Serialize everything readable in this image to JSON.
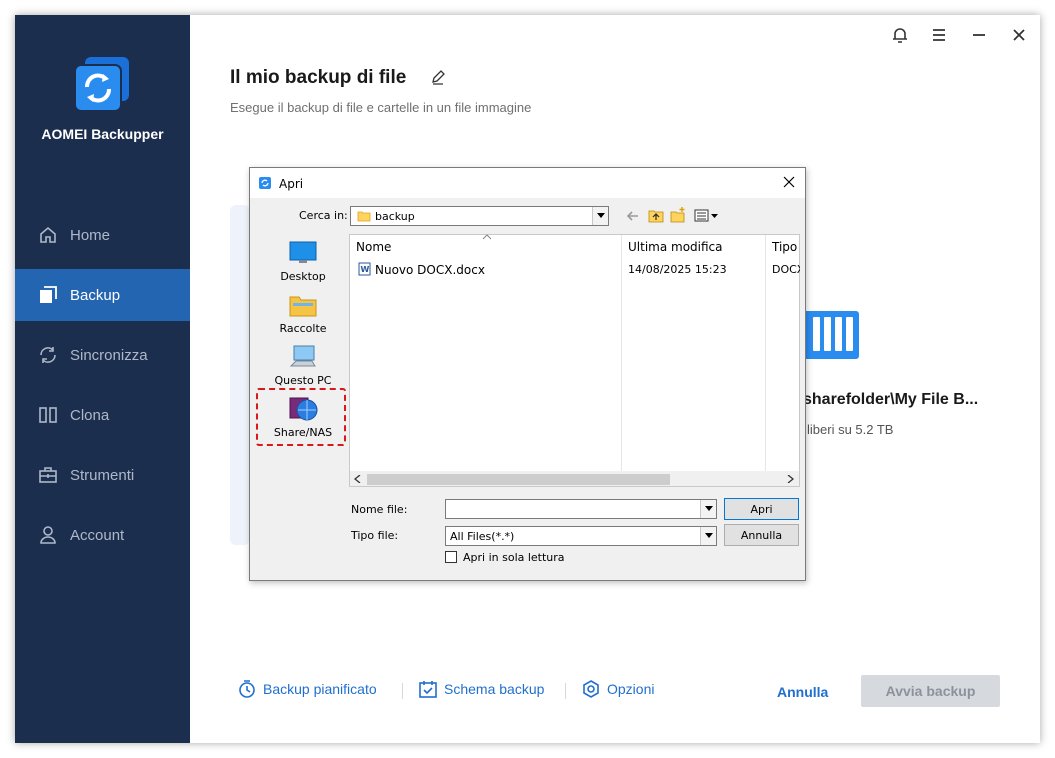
{
  "app": {
    "name": "AOMEI Backupper",
    "accent": "#2365b0",
    "sidebar_bg": "#1c2e4d"
  },
  "sidebar": {
    "items": [
      {
        "label": "Home",
        "icon": "home-icon"
      },
      {
        "label": "Backup",
        "icon": "backup-icon",
        "active": true
      },
      {
        "label": "Sincronizza",
        "icon": "sync-icon"
      },
      {
        "label": "Clona",
        "icon": "clone-icon"
      },
      {
        "label": "Strumenti",
        "icon": "tools-icon"
      },
      {
        "label": "Account",
        "icon": "account-icon"
      }
    ]
  },
  "window_controls": [
    "bell-icon",
    "menu-icon",
    "minimize-icon",
    "close-icon"
  ],
  "main": {
    "title": "Il mio backup di file",
    "subtitle": "Esegue il backup di file e cartelle in un file immagine",
    "destination": {
      "path": "sharefolder\\My File B...",
      "free": "liberi su 5.2 TB"
    },
    "bottom": {
      "scheduled": "Backup pianificato",
      "scheme": "Schema backup",
      "options": "Opzioni",
      "cancel": "Annulla",
      "start": "Avvia backup"
    }
  },
  "dialog": {
    "title": "Apri",
    "look_in_label": "Cerca in:",
    "look_in_value": "backup",
    "places": [
      "Desktop",
      "Raccolte",
      "Questo PC",
      "Share/NAS"
    ],
    "columns": [
      "Nome",
      "Ultima modifica",
      "Tipo"
    ],
    "files": [
      {
        "name": "Nuovo DOCX.docx",
        "modified": "14/08/2025 15:23",
        "type": "DOCX"
      }
    ],
    "filename_label": "Nome file:",
    "filename_value": "",
    "filetype_label": "Tipo file:",
    "filetype_value": "All Files(*.*)",
    "open_button": "Apri",
    "cancel_button": "Annulla",
    "readonly_label": "Apri in sola lettura"
  }
}
